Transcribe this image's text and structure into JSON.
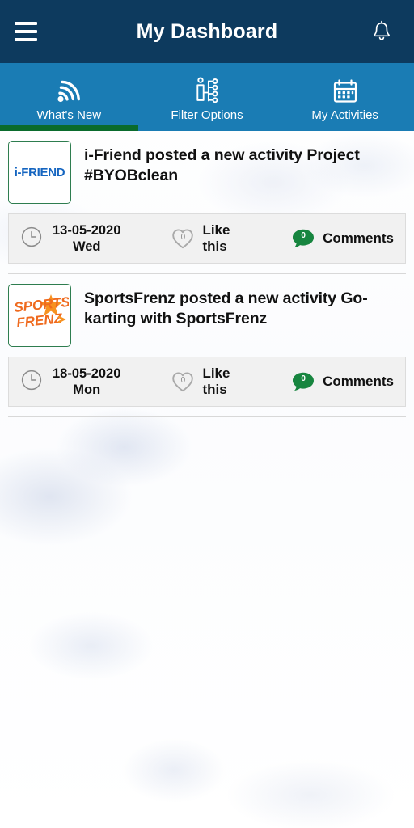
{
  "header": {
    "title": "My Dashboard",
    "menu_icon": "hamburger-menu-icon",
    "notification_icon": "bell-icon",
    "background_color": "#0d3a5e"
  },
  "tabs": {
    "background_color": "#1a7cb4",
    "active_indicator_color": "#0a6b2d",
    "items": [
      {
        "label": "What's New",
        "icon": "rss-feed-icon",
        "active": true
      },
      {
        "label": "Filter Options",
        "icon": "filter-sliders-icon",
        "active": false
      },
      {
        "label": "My Activities",
        "icon": "calendar-icon",
        "active": false
      }
    ]
  },
  "feed": {
    "items": [
      {
        "logo_text": "i-FRIEND",
        "logo_type": "ifriend-logo",
        "title": "i-Friend  posted a new activity Project #BYOBclean",
        "date": "13-05-2020",
        "day": "Wed",
        "clock_icon": "clock-icon",
        "like_icon": "heart-outline-icon",
        "like_count": "0",
        "like_label": "Like this",
        "comment_icon": "comment-bubble-icon",
        "comment_count": "0",
        "comment_label": "Comments"
      },
      {
        "logo_text": "SPORTS FRENZ",
        "logo_type": "sportsfrenz-logo",
        "title": "SportsFrenz posted a new activity Go-karting with SportsFrenz",
        "date": "18-05-2020",
        "day": "Mon",
        "clock_icon": "clock-icon",
        "like_icon": "heart-outline-icon",
        "like_count": "0",
        "like_label": "Like this",
        "comment_icon": "comment-bubble-icon",
        "comment_count": "0",
        "comment_label": "Comments"
      }
    ]
  },
  "colors": {
    "header_navy": "#0d3a5e",
    "tab_blue": "#1a7cb4",
    "active_green": "#0a6b2d",
    "comment_green": "#17853f",
    "logo_border_green": "#2e7d4f",
    "ifriend_blue": "#1565c0",
    "sportsfrenz_orange": "#f07a20",
    "meta_bg": "#f1f1f1"
  }
}
